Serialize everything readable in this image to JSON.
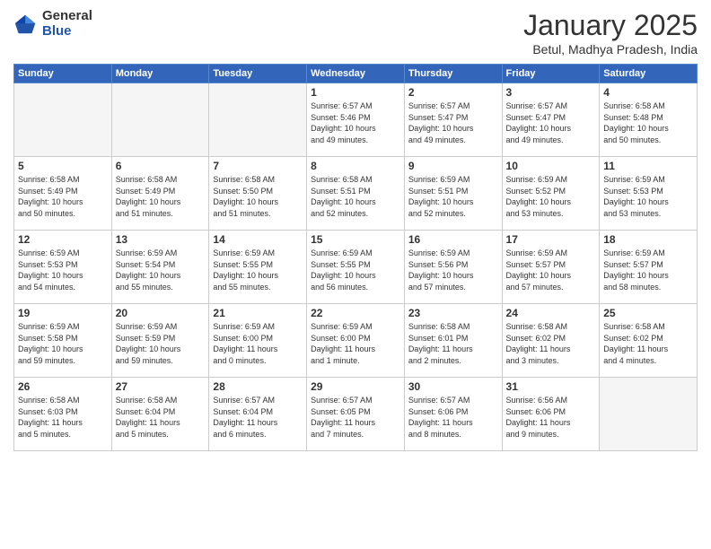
{
  "logo": {
    "general": "General",
    "blue": "Blue"
  },
  "title": "January 2025",
  "location": "Betul, Madhya Pradesh, India",
  "weekdays": [
    "Sunday",
    "Monday",
    "Tuesday",
    "Wednesday",
    "Thursday",
    "Friday",
    "Saturday"
  ],
  "weeks": [
    [
      {
        "day": "",
        "info": ""
      },
      {
        "day": "",
        "info": ""
      },
      {
        "day": "",
        "info": ""
      },
      {
        "day": "1",
        "info": "Sunrise: 6:57 AM\nSunset: 5:46 PM\nDaylight: 10 hours\nand 49 minutes."
      },
      {
        "day": "2",
        "info": "Sunrise: 6:57 AM\nSunset: 5:47 PM\nDaylight: 10 hours\nand 49 minutes."
      },
      {
        "day": "3",
        "info": "Sunrise: 6:57 AM\nSunset: 5:47 PM\nDaylight: 10 hours\nand 49 minutes."
      },
      {
        "day": "4",
        "info": "Sunrise: 6:58 AM\nSunset: 5:48 PM\nDaylight: 10 hours\nand 50 minutes."
      }
    ],
    [
      {
        "day": "5",
        "info": "Sunrise: 6:58 AM\nSunset: 5:49 PM\nDaylight: 10 hours\nand 50 minutes."
      },
      {
        "day": "6",
        "info": "Sunrise: 6:58 AM\nSunset: 5:49 PM\nDaylight: 10 hours\nand 51 minutes."
      },
      {
        "day": "7",
        "info": "Sunrise: 6:58 AM\nSunset: 5:50 PM\nDaylight: 10 hours\nand 51 minutes."
      },
      {
        "day": "8",
        "info": "Sunrise: 6:58 AM\nSunset: 5:51 PM\nDaylight: 10 hours\nand 52 minutes."
      },
      {
        "day": "9",
        "info": "Sunrise: 6:59 AM\nSunset: 5:51 PM\nDaylight: 10 hours\nand 52 minutes."
      },
      {
        "day": "10",
        "info": "Sunrise: 6:59 AM\nSunset: 5:52 PM\nDaylight: 10 hours\nand 53 minutes."
      },
      {
        "day": "11",
        "info": "Sunrise: 6:59 AM\nSunset: 5:53 PM\nDaylight: 10 hours\nand 53 minutes."
      }
    ],
    [
      {
        "day": "12",
        "info": "Sunrise: 6:59 AM\nSunset: 5:53 PM\nDaylight: 10 hours\nand 54 minutes."
      },
      {
        "day": "13",
        "info": "Sunrise: 6:59 AM\nSunset: 5:54 PM\nDaylight: 10 hours\nand 55 minutes."
      },
      {
        "day": "14",
        "info": "Sunrise: 6:59 AM\nSunset: 5:55 PM\nDaylight: 10 hours\nand 55 minutes."
      },
      {
        "day": "15",
        "info": "Sunrise: 6:59 AM\nSunset: 5:55 PM\nDaylight: 10 hours\nand 56 minutes."
      },
      {
        "day": "16",
        "info": "Sunrise: 6:59 AM\nSunset: 5:56 PM\nDaylight: 10 hours\nand 57 minutes."
      },
      {
        "day": "17",
        "info": "Sunrise: 6:59 AM\nSunset: 5:57 PM\nDaylight: 10 hours\nand 57 minutes."
      },
      {
        "day": "18",
        "info": "Sunrise: 6:59 AM\nSunset: 5:57 PM\nDaylight: 10 hours\nand 58 minutes."
      }
    ],
    [
      {
        "day": "19",
        "info": "Sunrise: 6:59 AM\nSunset: 5:58 PM\nDaylight: 10 hours\nand 59 minutes."
      },
      {
        "day": "20",
        "info": "Sunrise: 6:59 AM\nSunset: 5:59 PM\nDaylight: 10 hours\nand 59 minutes."
      },
      {
        "day": "21",
        "info": "Sunrise: 6:59 AM\nSunset: 6:00 PM\nDaylight: 11 hours\nand 0 minutes."
      },
      {
        "day": "22",
        "info": "Sunrise: 6:59 AM\nSunset: 6:00 PM\nDaylight: 11 hours\nand 1 minute."
      },
      {
        "day": "23",
        "info": "Sunrise: 6:58 AM\nSunset: 6:01 PM\nDaylight: 11 hours\nand 2 minutes."
      },
      {
        "day": "24",
        "info": "Sunrise: 6:58 AM\nSunset: 6:02 PM\nDaylight: 11 hours\nand 3 minutes."
      },
      {
        "day": "25",
        "info": "Sunrise: 6:58 AM\nSunset: 6:02 PM\nDaylight: 11 hours\nand 4 minutes."
      }
    ],
    [
      {
        "day": "26",
        "info": "Sunrise: 6:58 AM\nSunset: 6:03 PM\nDaylight: 11 hours\nand 5 minutes."
      },
      {
        "day": "27",
        "info": "Sunrise: 6:58 AM\nSunset: 6:04 PM\nDaylight: 11 hours\nand 5 minutes."
      },
      {
        "day": "28",
        "info": "Sunrise: 6:57 AM\nSunset: 6:04 PM\nDaylight: 11 hours\nand 6 minutes."
      },
      {
        "day": "29",
        "info": "Sunrise: 6:57 AM\nSunset: 6:05 PM\nDaylight: 11 hours\nand 7 minutes."
      },
      {
        "day": "30",
        "info": "Sunrise: 6:57 AM\nSunset: 6:06 PM\nDaylight: 11 hours\nand 8 minutes."
      },
      {
        "day": "31",
        "info": "Sunrise: 6:56 AM\nSunset: 6:06 PM\nDaylight: 11 hours\nand 9 minutes."
      },
      {
        "day": "",
        "info": ""
      }
    ]
  ]
}
